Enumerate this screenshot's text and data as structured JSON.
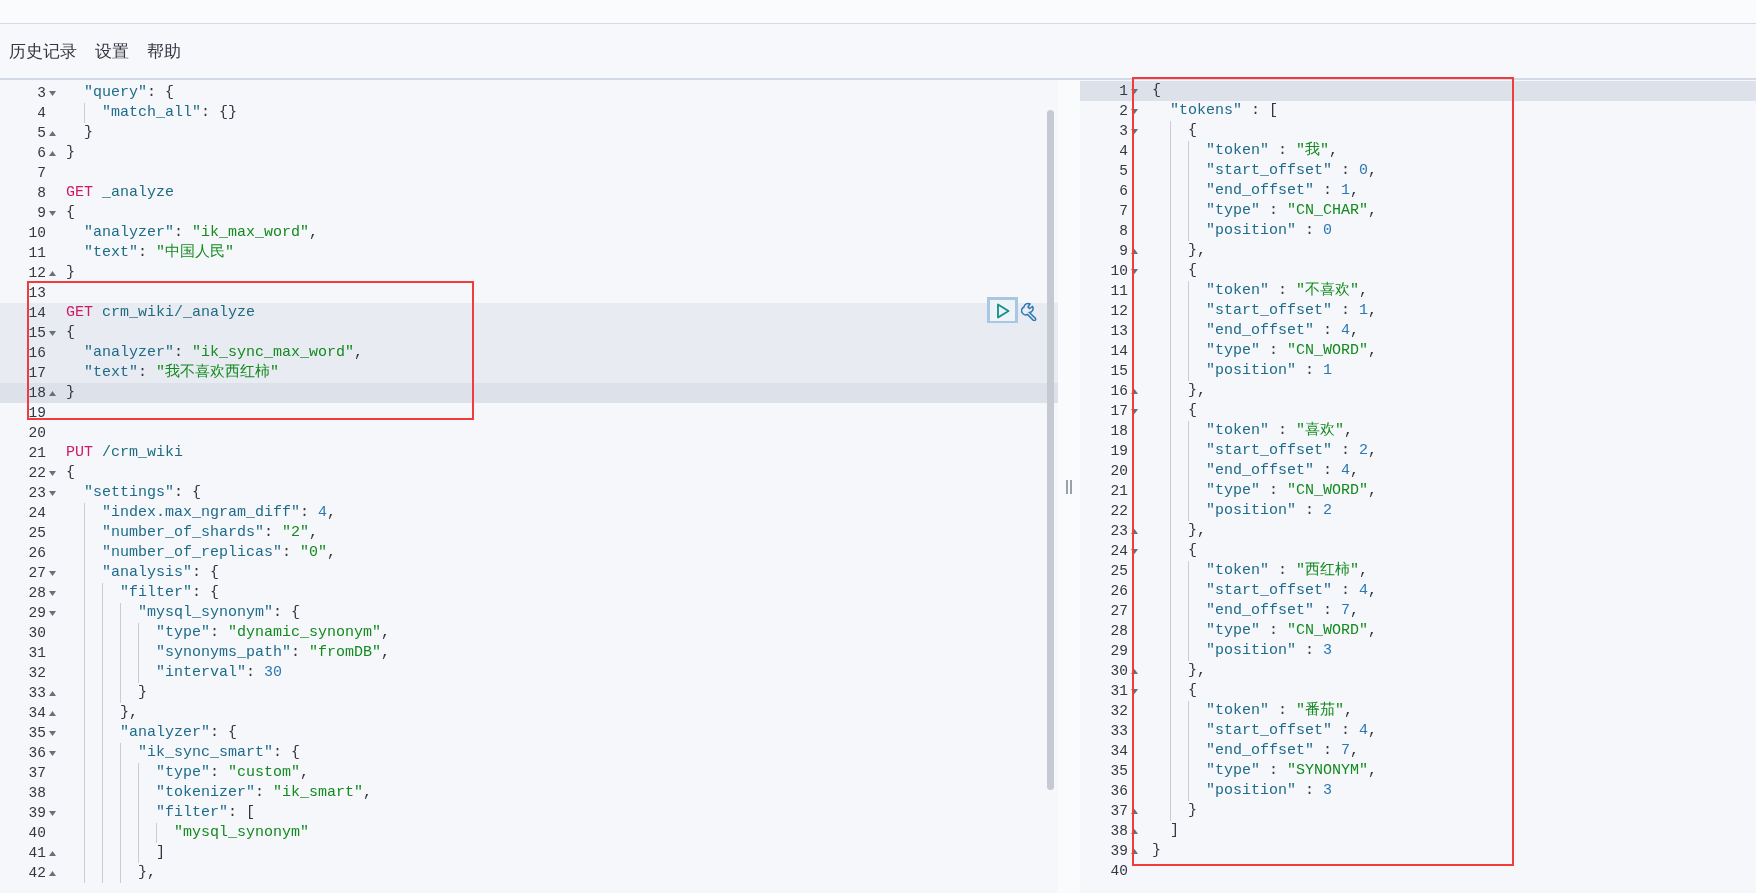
{
  "menu": [
    {
      "label": "历史记录"
    },
    {
      "label": "设置"
    },
    {
      "label": "帮助"
    }
  ],
  "request_editor": {
    "lines": [
      {
        "number": "3",
        "kind": "opener",
        "selected": false,
        "active": false,
        "tokens": [
          {
            "kind": "key",
            "text": "  \"query\""
          },
          {
            "kind": "punct",
            "text": ": {"
          }
        ]
      },
      {
        "number": "4",
        "kind": "plain",
        "selected": false,
        "active": false,
        "tokens": [
          {
            "kind": "key",
            "text": "    \"match_all\""
          },
          {
            "kind": "punct",
            "text": ": {}"
          }
        ]
      },
      {
        "number": "5",
        "kind": "closer",
        "selected": false,
        "active": false,
        "tokens": [
          {
            "kind": "punct",
            "text": "  }"
          }
        ]
      },
      {
        "number": "6",
        "kind": "closer",
        "selected": false,
        "active": false,
        "tokens": [
          {
            "kind": "punct",
            "text": "}"
          }
        ]
      },
      {
        "number": "7",
        "kind": "plain",
        "selected": false,
        "active": false
      },
      {
        "number": "8",
        "kind": "plain",
        "selected": false,
        "active": false,
        "tokens": [
          {
            "kind": "method",
            "text": "GET"
          },
          {
            "kind": "path",
            "text": " _analyze"
          }
        ]
      },
      {
        "number": "9",
        "kind": "opener",
        "selected": false,
        "active": false,
        "tokens": [
          {
            "kind": "punct",
            "text": "{"
          }
        ]
      },
      {
        "number": "10",
        "kind": "plain",
        "selected": false,
        "active": false,
        "tokens": [
          {
            "kind": "key",
            "text": "  \"analyzer\""
          },
          {
            "kind": "punct",
            "text": ": "
          },
          {
            "kind": "string",
            "text": "\"ik_max_word\""
          },
          {
            "kind": "punct",
            "text": ","
          }
        ]
      },
      {
        "number": "11",
        "kind": "plain",
        "selected": false,
        "active": false,
        "tokens": [
          {
            "kind": "key",
            "text": "  \"text\""
          },
          {
            "kind": "punct",
            "text": ": "
          },
          {
            "kind": "string",
            "text": "\"中国人民\""
          }
        ]
      },
      {
        "number": "12",
        "kind": "closer",
        "selected": false,
        "active": false,
        "tokens": [
          {
            "kind": "punct",
            "text": "}"
          }
        ]
      },
      {
        "number": "13",
        "kind": "plain",
        "selected": false,
        "active": false
      },
      {
        "number": "14",
        "kind": "plain",
        "selected": true,
        "active": false,
        "tokens": [
          {
            "kind": "method",
            "text": "GET"
          },
          {
            "kind": "path",
            "text": " crm_wiki/_analyze"
          }
        ]
      },
      {
        "number": "15",
        "kind": "opener",
        "selected": true,
        "active": false,
        "tokens": [
          {
            "kind": "punct",
            "text": "{"
          }
        ]
      },
      {
        "number": "16",
        "kind": "plain",
        "selected": true,
        "active": false,
        "tokens": [
          {
            "kind": "key",
            "text": "  \"analyzer\""
          },
          {
            "kind": "punct",
            "text": ": "
          },
          {
            "kind": "string",
            "text": "\"ik_sync_max_word\""
          },
          {
            "kind": "punct",
            "text": ","
          }
        ]
      },
      {
        "number": "17",
        "kind": "plain",
        "selected": true,
        "active": false,
        "tokens": [
          {
            "kind": "key",
            "text": "  \"text\""
          },
          {
            "kind": "punct",
            "text": ": "
          },
          {
            "kind": "string",
            "text": "\"我不喜欢西红柿\""
          }
        ]
      },
      {
        "number": "18",
        "kind": "closer",
        "selected": false,
        "active": true,
        "tokens": [
          {
            "kind": "punct",
            "text": "}"
          }
        ]
      },
      {
        "number": "19",
        "kind": "plain",
        "selected": false,
        "active": false
      },
      {
        "number": "20",
        "kind": "plain",
        "selected": false,
        "active": false
      },
      {
        "number": "21",
        "kind": "plain",
        "selected": false,
        "active": false,
        "tokens": [
          {
            "kind": "method",
            "text": "PUT"
          },
          {
            "kind": "path",
            "text": " /crm_wiki"
          }
        ]
      },
      {
        "number": "22",
        "kind": "opener",
        "selected": false,
        "active": false,
        "tokens": [
          {
            "kind": "punct",
            "text": "{"
          }
        ]
      },
      {
        "number": "23",
        "kind": "opener",
        "selected": false,
        "active": false,
        "tokens": [
          {
            "kind": "key",
            "text": "  \"settings\""
          },
          {
            "kind": "punct",
            "text": ": {"
          }
        ]
      },
      {
        "number": "24",
        "kind": "plain",
        "selected": false,
        "active": false,
        "tokens": [
          {
            "kind": "key",
            "text": "    \"index.max_ngram_diff\""
          },
          {
            "kind": "punct",
            "text": ": "
          },
          {
            "kind": "number",
            "text": "4"
          },
          {
            "kind": "punct",
            "text": ","
          }
        ]
      },
      {
        "number": "25",
        "kind": "plain",
        "selected": false,
        "active": false,
        "tokens": [
          {
            "kind": "key",
            "text": "    \"number_of_shards\""
          },
          {
            "kind": "punct",
            "text": ": "
          },
          {
            "kind": "string",
            "text": "\"2\""
          },
          {
            "kind": "punct",
            "text": ","
          }
        ]
      },
      {
        "number": "26",
        "kind": "plain",
        "selected": false,
        "active": false,
        "tokens": [
          {
            "kind": "key",
            "text": "    \"number_of_replicas\""
          },
          {
            "kind": "punct",
            "text": ": "
          },
          {
            "kind": "string",
            "text": "\"0\""
          },
          {
            "kind": "punct",
            "text": ","
          }
        ]
      },
      {
        "number": "27",
        "kind": "opener",
        "selected": false,
        "active": false,
        "tokens": [
          {
            "kind": "key",
            "text": "    \"analysis\""
          },
          {
            "kind": "punct",
            "text": ": {"
          }
        ]
      },
      {
        "number": "28",
        "kind": "opener",
        "selected": false,
        "active": false,
        "tokens": [
          {
            "kind": "key",
            "text": "      \"filter\""
          },
          {
            "kind": "punct",
            "text": ": {"
          }
        ]
      },
      {
        "number": "29",
        "kind": "opener",
        "selected": false,
        "active": false,
        "tokens": [
          {
            "kind": "key",
            "text": "        \"mysql_synonym\""
          },
          {
            "kind": "punct",
            "text": ": {"
          }
        ]
      },
      {
        "number": "30",
        "kind": "plain",
        "selected": false,
        "active": false,
        "tokens": [
          {
            "kind": "key",
            "text": "          \"type\""
          },
          {
            "kind": "punct",
            "text": ": "
          },
          {
            "kind": "string",
            "text": "\"dynamic_synonym\""
          },
          {
            "kind": "punct",
            "text": ","
          }
        ]
      },
      {
        "number": "31",
        "kind": "plain",
        "selected": false,
        "active": false,
        "tokens": [
          {
            "kind": "key",
            "text": "          \"synonyms_path\""
          },
          {
            "kind": "punct",
            "text": ": "
          },
          {
            "kind": "string",
            "text": "\"fromDB\""
          },
          {
            "kind": "punct",
            "text": ","
          }
        ]
      },
      {
        "number": "32",
        "kind": "plain",
        "selected": false,
        "active": false,
        "tokens": [
          {
            "kind": "key",
            "text": "          \"interval\""
          },
          {
            "kind": "punct",
            "text": ": "
          },
          {
            "kind": "number",
            "text": "30"
          }
        ]
      },
      {
        "number": "33",
        "kind": "closer",
        "selected": false,
        "active": false,
        "tokens": [
          {
            "kind": "punct",
            "text": "        }"
          }
        ]
      },
      {
        "number": "34",
        "kind": "closer",
        "selected": false,
        "active": false,
        "tokens": [
          {
            "kind": "punct",
            "text": "      },"
          }
        ]
      },
      {
        "number": "35",
        "kind": "opener",
        "selected": false,
        "active": false,
        "tokens": [
          {
            "kind": "key",
            "text": "      \"analyzer\""
          },
          {
            "kind": "punct",
            "text": ": {"
          }
        ]
      },
      {
        "number": "36",
        "kind": "opener",
        "selected": false,
        "active": false,
        "tokens": [
          {
            "kind": "key",
            "text": "        \"ik_sync_smart\""
          },
          {
            "kind": "punct",
            "text": ": {"
          }
        ]
      },
      {
        "number": "37",
        "kind": "plain",
        "selected": false,
        "active": false,
        "tokens": [
          {
            "kind": "key",
            "text": "          \"type\""
          },
          {
            "kind": "punct",
            "text": ": "
          },
          {
            "kind": "string",
            "text": "\"custom\""
          },
          {
            "kind": "punct",
            "text": ","
          }
        ]
      },
      {
        "number": "38",
        "kind": "plain",
        "selected": false,
        "active": false,
        "tokens": [
          {
            "kind": "key",
            "text": "          \"tokenizer\""
          },
          {
            "kind": "punct",
            "text": ": "
          },
          {
            "kind": "string",
            "text": "\"ik_smart\""
          },
          {
            "kind": "punct",
            "text": ","
          }
        ]
      },
      {
        "number": "39",
        "kind": "opener",
        "selected": false,
        "active": false,
        "tokens": [
          {
            "kind": "key",
            "text": "          \"filter\""
          },
          {
            "kind": "punct",
            "text": ": ["
          }
        ]
      },
      {
        "number": "40",
        "kind": "plain",
        "selected": false,
        "active": false,
        "tokens": [
          {
            "kind": "string",
            "text": "            \"mysql_synonym\""
          }
        ]
      },
      {
        "number": "41",
        "kind": "closer",
        "selected": false,
        "active": false,
        "tokens": [
          {
            "kind": "punct",
            "text": "          ]"
          }
        ]
      },
      {
        "number": "42",
        "kind": "closer",
        "selected": false,
        "active": false,
        "tokens": [
          {
            "kind": "punct",
            "text": "        },"
          }
        ]
      }
    ]
  },
  "response_viewer": {
    "lines": [
      {
        "number": "1",
        "kind": "opener",
        "active": true,
        "tokens": [
          {
            "kind": "punct",
            "text": "{"
          }
        ]
      },
      {
        "number": "2",
        "kind": "opener",
        "active": false,
        "tokens": [
          {
            "kind": "key",
            "text": "  \"tokens\""
          },
          {
            "kind": "punct",
            "text": " : ["
          }
        ]
      },
      {
        "number": "3",
        "kind": "opener",
        "active": false,
        "tokens": [
          {
            "kind": "punct",
            "text": "    {"
          }
        ]
      },
      {
        "number": "4",
        "kind": "plain",
        "active": false,
        "tokens": [
          {
            "kind": "key",
            "text": "      \"token\""
          },
          {
            "kind": "punct",
            "text": " : "
          },
          {
            "kind": "string",
            "text": "\"我\""
          },
          {
            "kind": "punct",
            "text": ","
          }
        ]
      },
      {
        "number": "5",
        "kind": "plain",
        "active": false,
        "tokens": [
          {
            "kind": "key",
            "text": "      \"start_offset\""
          },
          {
            "kind": "punct",
            "text": " : "
          },
          {
            "kind": "number",
            "text": "0"
          },
          {
            "kind": "punct",
            "text": ","
          }
        ]
      },
      {
        "number": "6",
        "kind": "plain",
        "active": false,
        "tokens": [
          {
            "kind": "key",
            "text": "      \"end_offset\""
          },
          {
            "kind": "punct",
            "text": " : "
          },
          {
            "kind": "number",
            "text": "1"
          },
          {
            "kind": "punct",
            "text": ","
          }
        ]
      },
      {
        "number": "7",
        "kind": "plain",
        "active": false,
        "tokens": [
          {
            "kind": "key",
            "text": "      \"type\""
          },
          {
            "kind": "punct",
            "text": " : "
          },
          {
            "kind": "string",
            "text": "\"CN_CHAR\""
          },
          {
            "kind": "punct",
            "text": ","
          }
        ]
      },
      {
        "number": "8",
        "kind": "plain",
        "active": false,
        "tokens": [
          {
            "kind": "key",
            "text": "      \"position\""
          },
          {
            "kind": "punct",
            "text": " : "
          },
          {
            "kind": "number",
            "text": "0"
          }
        ]
      },
      {
        "number": "9",
        "kind": "closer",
        "active": false,
        "tokens": [
          {
            "kind": "punct",
            "text": "    },"
          }
        ]
      },
      {
        "number": "10",
        "kind": "opener",
        "active": false,
        "tokens": [
          {
            "kind": "punct",
            "text": "    {"
          }
        ]
      },
      {
        "number": "11",
        "kind": "plain",
        "active": false,
        "tokens": [
          {
            "kind": "key",
            "text": "      \"token\""
          },
          {
            "kind": "punct",
            "text": " : "
          },
          {
            "kind": "string",
            "text": "\"不喜欢\""
          },
          {
            "kind": "punct",
            "text": ","
          }
        ]
      },
      {
        "number": "12",
        "kind": "plain",
        "active": false,
        "tokens": [
          {
            "kind": "key",
            "text": "      \"start_offset\""
          },
          {
            "kind": "punct",
            "text": " : "
          },
          {
            "kind": "number",
            "text": "1"
          },
          {
            "kind": "punct",
            "text": ","
          }
        ]
      },
      {
        "number": "13",
        "kind": "plain",
        "active": false,
        "tokens": [
          {
            "kind": "key",
            "text": "      \"end_offset\""
          },
          {
            "kind": "punct",
            "text": " : "
          },
          {
            "kind": "number",
            "text": "4"
          },
          {
            "kind": "punct",
            "text": ","
          }
        ]
      },
      {
        "number": "14",
        "kind": "plain",
        "active": false,
        "tokens": [
          {
            "kind": "key",
            "text": "      \"type\""
          },
          {
            "kind": "punct",
            "text": " : "
          },
          {
            "kind": "string",
            "text": "\"CN_WORD\""
          },
          {
            "kind": "punct",
            "text": ","
          }
        ]
      },
      {
        "number": "15",
        "kind": "plain",
        "active": false,
        "tokens": [
          {
            "kind": "key",
            "text": "      \"position\""
          },
          {
            "kind": "punct",
            "text": " : "
          },
          {
            "kind": "number",
            "text": "1"
          }
        ]
      },
      {
        "number": "16",
        "kind": "closer",
        "active": false,
        "tokens": [
          {
            "kind": "punct",
            "text": "    },"
          }
        ]
      },
      {
        "number": "17",
        "kind": "opener",
        "active": false,
        "tokens": [
          {
            "kind": "punct",
            "text": "    {"
          }
        ]
      },
      {
        "number": "18",
        "kind": "plain",
        "active": false,
        "tokens": [
          {
            "kind": "key",
            "text": "      \"token\""
          },
          {
            "kind": "punct",
            "text": " : "
          },
          {
            "kind": "string",
            "text": "\"喜欢\""
          },
          {
            "kind": "punct",
            "text": ","
          }
        ]
      },
      {
        "number": "19",
        "kind": "plain",
        "active": false,
        "tokens": [
          {
            "kind": "key",
            "text": "      \"start_offset\""
          },
          {
            "kind": "punct",
            "text": " : "
          },
          {
            "kind": "number",
            "text": "2"
          },
          {
            "kind": "punct",
            "text": ","
          }
        ]
      },
      {
        "number": "20",
        "kind": "plain",
        "active": false,
        "tokens": [
          {
            "kind": "key",
            "text": "      \"end_offset\""
          },
          {
            "kind": "punct",
            "text": " : "
          },
          {
            "kind": "number",
            "text": "4"
          },
          {
            "kind": "punct",
            "text": ","
          }
        ]
      },
      {
        "number": "21",
        "kind": "plain",
        "active": false,
        "tokens": [
          {
            "kind": "key",
            "text": "      \"type\""
          },
          {
            "kind": "punct",
            "text": " : "
          },
          {
            "kind": "string",
            "text": "\"CN_WORD\""
          },
          {
            "kind": "punct",
            "text": ","
          }
        ]
      },
      {
        "number": "22",
        "kind": "plain",
        "active": false,
        "tokens": [
          {
            "kind": "key",
            "text": "      \"position\""
          },
          {
            "kind": "punct",
            "text": " : "
          },
          {
            "kind": "number",
            "text": "2"
          }
        ]
      },
      {
        "number": "23",
        "kind": "closer",
        "active": false,
        "tokens": [
          {
            "kind": "punct",
            "text": "    },"
          }
        ]
      },
      {
        "number": "24",
        "kind": "opener",
        "active": false,
        "tokens": [
          {
            "kind": "punct",
            "text": "    {"
          }
        ]
      },
      {
        "number": "25",
        "kind": "plain",
        "active": false,
        "tokens": [
          {
            "kind": "key",
            "text": "      \"token\""
          },
          {
            "kind": "punct",
            "text": " : "
          },
          {
            "kind": "string",
            "text": "\"西红柿\""
          },
          {
            "kind": "punct",
            "text": ","
          }
        ]
      },
      {
        "number": "26",
        "kind": "plain",
        "active": false,
        "tokens": [
          {
            "kind": "key",
            "text": "      \"start_offset\""
          },
          {
            "kind": "punct",
            "text": " : "
          },
          {
            "kind": "number",
            "text": "4"
          },
          {
            "kind": "punct",
            "text": ","
          }
        ]
      },
      {
        "number": "27",
        "kind": "plain",
        "active": false,
        "tokens": [
          {
            "kind": "key",
            "text": "      \"end_offset\""
          },
          {
            "kind": "punct",
            "text": " : "
          },
          {
            "kind": "number",
            "text": "7"
          },
          {
            "kind": "punct",
            "text": ","
          }
        ]
      },
      {
        "number": "28",
        "kind": "plain",
        "active": false,
        "tokens": [
          {
            "kind": "key",
            "text": "      \"type\""
          },
          {
            "kind": "punct",
            "text": " : "
          },
          {
            "kind": "string",
            "text": "\"CN_WORD\""
          },
          {
            "kind": "punct",
            "text": ","
          }
        ]
      },
      {
        "number": "29",
        "kind": "plain",
        "active": false,
        "tokens": [
          {
            "kind": "key",
            "text": "      \"position\""
          },
          {
            "kind": "punct",
            "text": " : "
          },
          {
            "kind": "number",
            "text": "3"
          }
        ]
      },
      {
        "number": "30",
        "kind": "closer",
        "active": false,
        "tokens": [
          {
            "kind": "punct",
            "text": "    },"
          }
        ]
      },
      {
        "number": "31",
        "kind": "opener",
        "active": false,
        "tokens": [
          {
            "kind": "punct",
            "text": "    {"
          }
        ]
      },
      {
        "number": "32",
        "kind": "plain",
        "active": false,
        "tokens": [
          {
            "kind": "key",
            "text": "      \"token\""
          },
          {
            "kind": "punct",
            "text": " : "
          },
          {
            "kind": "string",
            "text": "\"番茄\""
          },
          {
            "kind": "punct",
            "text": ","
          }
        ]
      },
      {
        "number": "33",
        "kind": "plain",
        "active": false,
        "tokens": [
          {
            "kind": "key",
            "text": "      \"start_offset\""
          },
          {
            "kind": "punct",
            "text": " : "
          },
          {
            "kind": "number",
            "text": "4"
          },
          {
            "kind": "punct",
            "text": ","
          }
        ]
      },
      {
        "number": "34",
        "kind": "plain",
        "active": false,
        "tokens": [
          {
            "kind": "key",
            "text": "      \"end_offset\""
          },
          {
            "kind": "punct",
            "text": " : "
          },
          {
            "kind": "number",
            "text": "7"
          },
          {
            "kind": "punct",
            "text": ","
          }
        ]
      },
      {
        "number": "35",
        "kind": "plain",
        "active": false,
        "tokens": [
          {
            "kind": "key",
            "text": "      \"type\""
          },
          {
            "kind": "punct",
            "text": " : "
          },
          {
            "kind": "string",
            "text": "\"SYNONYM\""
          },
          {
            "kind": "punct",
            "text": ","
          }
        ]
      },
      {
        "number": "36",
        "kind": "plain",
        "active": false,
        "tokens": [
          {
            "kind": "key",
            "text": "      \"position\""
          },
          {
            "kind": "punct",
            "text": " : "
          },
          {
            "kind": "number",
            "text": "3"
          }
        ]
      },
      {
        "number": "37",
        "kind": "closer",
        "active": false,
        "tokens": [
          {
            "kind": "punct",
            "text": "    }"
          }
        ]
      },
      {
        "number": "38",
        "kind": "closer",
        "active": false,
        "tokens": [
          {
            "kind": "punct",
            "text": "  ]"
          }
        ]
      },
      {
        "number": "39",
        "kind": "closer",
        "active": false,
        "tokens": [
          {
            "kind": "punct",
            "text": "}"
          }
        ]
      },
      {
        "number": "40",
        "kind": "plain",
        "active": false
      }
    ]
  }
}
